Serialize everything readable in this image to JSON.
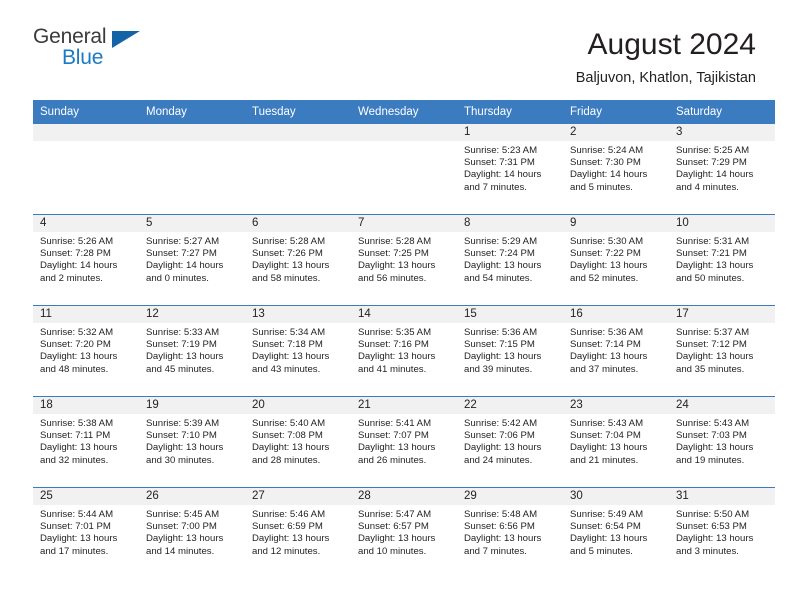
{
  "brand": {
    "name_part1": "General",
    "name_part2": "Blue",
    "flag_icon": "blue-triangle-flag"
  },
  "header": {
    "title": "August 2024",
    "location": "Baljuvon, Khatlon, Tajikistan"
  },
  "calendar": {
    "weekday_headers": [
      "Sunday",
      "Monday",
      "Tuesday",
      "Wednesday",
      "Thursday",
      "Friday",
      "Saturday"
    ],
    "colors": {
      "header_background": "#3b7cc0",
      "header_text": "#ffffff",
      "daynumber_background": "#f1f1f1",
      "cell_background": "#ffffff",
      "row_divider": "#3b7cc0",
      "brand_blue": "#1a7bc4",
      "text": "#231f20"
    },
    "weeks": [
      [
        {
          "day": "",
          "sunrise": "",
          "sunset": "",
          "daylight_line1": "",
          "daylight_line2": "",
          "empty": true
        },
        {
          "day": "",
          "sunrise": "",
          "sunset": "",
          "daylight_line1": "",
          "daylight_line2": "",
          "empty": true
        },
        {
          "day": "",
          "sunrise": "",
          "sunset": "",
          "daylight_line1": "",
          "daylight_line2": "",
          "empty": true
        },
        {
          "day": "",
          "sunrise": "",
          "sunset": "",
          "daylight_line1": "",
          "daylight_line2": "",
          "empty": true
        },
        {
          "day": "1",
          "sunrise": "Sunrise: 5:23 AM",
          "sunset": "Sunset: 7:31 PM",
          "daylight_line1": "Daylight: 14 hours",
          "daylight_line2": "and 7 minutes."
        },
        {
          "day": "2",
          "sunrise": "Sunrise: 5:24 AM",
          "sunset": "Sunset: 7:30 PM",
          "daylight_line1": "Daylight: 14 hours",
          "daylight_line2": "and 5 minutes."
        },
        {
          "day": "3",
          "sunrise": "Sunrise: 5:25 AM",
          "sunset": "Sunset: 7:29 PM",
          "daylight_line1": "Daylight: 14 hours",
          "daylight_line2": "and 4 minutes."
        }
      ],
      [
        {
          "day": "4",
          "sunrise": "Sunrise: 5:26 AM",
          "sunset": "Sunset: 7:28 PM",
          "daylight_line1": "Daylight: 14 hours",
          "daylight_line2": "and 2 minutes."
        },
        {
          "day": "5",
          "sunrise": "Sunrise: 5:27 AM",
          "sunset": "Sunset: 7:27 PM",
          "daylight_line1": "Daylight: 14 hours",
          "daylight_line2": "and 0 minutes."
        },
        {
          "day": "6",
          "sunrise": "Sunrise: 5:28 AM",
          "sunset": "Sunset: 7:26 PM",
          "daylight_line1": "Daylight: 13 hours",
          "daylight_line2": "and 58 minutes."
        },
        {
          "day": "7",
          "sunrise": "Sunrise: 5:28 AM",
          "sunset": "Sunset: 7:25 PM",
          "daylight_line1": "Daylight: 13 hours",
          "daylight_line2": "and 56 minutes."
        },
        {
          "day": "8",
          "sunrise": "Sunrise: 5:29 AM",
          "sunset": "Sunset: 7:24 PM",
          "daylight_line1": "Daylight: 13 hours",
          "daylight_line2": "and 54 minutes."
        },
        {
          "day": "9",
          "sunrise": "Sunrise: 5:30 AM",
          "sunset": "Sunset: 7:22 PM",
          "daylight_line1": "Daylight: 13 hours",
          "daylight_line2": "and 52 minutes."
        },
        {
          "day": "10",
          "sunrise": "Sunrise: 5:31 AM",
          "sunset": "Sunset: 7:21 PM",
          "daylight_line1": "Daylight: 13 hours",
          "daylight_line2": "and 50 minutes."
        }
      ],
      [
        {
          "day": "11",
          "sunrise": "Sunrise: 5:32 AM",
          "sunset": "Sunset: 7:20 PM",
          "daylight_line1": "Daylight: 13 hours",
          "daylight_line2": "and 48 minutes."
        },
        {
          "day": "12",
          "sunrise": "Sunrise: 5:33 AM",
          "sunset": "Sunset: 7:19 PM",
          "daylight_line1": "Daylight: 13 hours",
          "daylight_line2": "and 45 minutes."
        },
        {
          "day": "13",
          "sunrise": "Sunrise: 5:34 AM",
          "sunset": "Sunset: 7:18 PM",
          "daylight_line1": "Daylight: 13 hours",
          "daylight_line2": "and 43 minutes."
        },
        {
          "day": "14",
          "sunrise": "Sunrise: 5:35 AM",
          "sunset": "Sunset: 7:16 PM",
          "daylight_line1": "Daylight: 13 hours",
          "daylight_line2": "and 41 minutes."
        },
        {
          "day": "15",
          "sunrise": "Sunrise: 5:36 AM",
          "sunset": "Sunset: 7:15 PM",
          "daylight_line1": "Daylight: 13 hours",
          "daylight_line2": "and 39 minutes."
        },
        {
          "day": "16",
          "sunrise": "Sunrise: 5:36 AM",
          "sunset": "Sunset: 7:14 PM",
          "daylight_line1": "Daylight: 13 hours",
          "daylight_line2": "and 37 minutes."
        },
        {
          "day": "17",
          "sunrise": "Sunrise: 5:37 AM",
          "sunset": "Sunset: 7:12 PM",
          "daylight_line1": "Daylight: 13 hours",
          "daylight_line2": "and 35 minutes."
        }
      ],
      [
        {
          "day": "18",
          "sunrise": "Sunrise: 5:38 AM",
          "sunset": "Sunset: 7:11 PM",
          "daylight_line1": "Daylight: 13 hours",
          "daylight_line2": "and 32 minutes."
        },
        {
          "day": "19",
          "sunrise": "Sunrise: 5:39 AM",
          "sunset": "Sunset: 7:10 PM",
          "daylight_line1": "Daylight: 13 hours",
          "daylight_line2": "and 30 minutes."
        },
        {
          "day": "20",
          "sunrise": "Sunrise: 5:40 AM",
          "sunset": "Sunset: 7:08 PM",
          "daylight_line1": "Daylight: 13 hours",
          "daylight_line2": "and 28 minutes."
        },
        {
          "day": "21",
          "sunrise": "Sunrise: 5:41 AM",
          "sunset": "Sunset: 7:07 PM",
          "daylight_line1": "Daylight: 13 hours",
          "daylight_line2": "and 26 minutes."
        },
        {
          "day": "22",
          "sunrise": "Sunrise: 5:42 AM",
          "sunset": "Sunset: 7:06 PM",
          "daylight_line1": "Daylight: 13 hours",
          "daylight_line2": "and 24 minutes."
        },
        {
          "day": "23",
          "sunrise": "Sunrise: 5:43 AM",
          "sunset": "Sunset: 7:04 PM",
          "daylight_line1": "Daylight: 13 hours",
          "daylight_line2": "and 21 minutes."
        },
        {
          "day": "24",
          "sunrise": "Sunrise: 5:43 AM",
          "sunset": "Sunset: 7:03 PM",
          "daylight_line1": "Daylight: 13 hours",
          "daylight_line2": "and 19 minutes."
        }
      ],
      [
        {
          "day": "25",
          "sunrise": "Sunrise: 5:44 AM",
          "sunset": "Sunset: 7:01 PM",
          "daylight_line1": "Daylight: 13 hours",
          "daylight_line2": "and 17 minutes."
        },
        {
          "day": "26",
          "sunrise": "Sunrise: 5:45 AM",
          "sunset": "Sunset: 7:00 PM",
          "daylight_line1": "Daylight: 13 hours",
          "daylight_line2": "and 14 minutes."
        },
        {
          "day": "27",
          "sunrise": "Sunrise: 5:46 AM",
          "sunset": "Sunset: 6:59 PM",
          "daylight_line1": "Daylight: 13 hours",
          "daylight_line2": "and 12 minutes."
        },
        {
          "day": "28",
          "sunrise": "Sunrise: 5:47 AM",
          "sunset": "Sunset: 6:57 PM",
          "daylight_line1": "Daylight: 13 hours",
          "daylight_line2": "and 10 minutes."
        },
        {
          "day": "29",
          "sunrise": "Sunrise: 5:48 AM",
          "sunset": "Sunset: 6:56 PM",
          "daylight_line1": "Daylight: 13 hours",
          "daylight_line2": "and 7 minutes."
        },
        {
          "day": "30",
          "sunrise": "Sunrise: 5:49 AM",
          "sunset": "Sunset: 6:54 PM",
          "daylight_line1": "Daylight: 13 hours",
          "daylight_line2": "and 5 minutes."
        },
        {
          "day": "31",
          "sunrise": "Sunrise: 5:50 AM",
          "sunset": "Sunset: 6:53 PM",
          "daylight_line1": "Daylight: 13 hours",
          "daylight_line2": "and 3 minutes."
        }
      ]
    ]
  }
}
